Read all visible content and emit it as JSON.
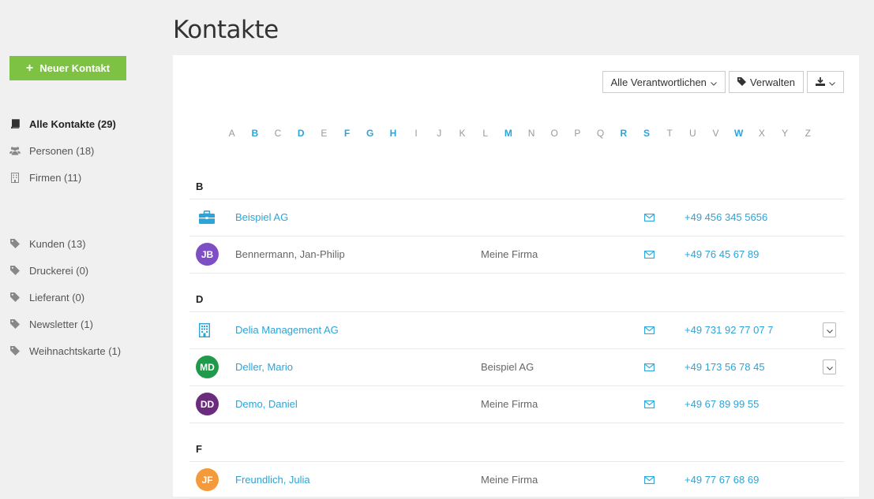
{
  "page": {
    "title": "Kontakte"
  },
  "new_button": {
    "label": "Neuer Kontakt"
  },
  "sidebar": {
    "items": [
      {
        "label": "Alle Kontakte (29)",
        "icon": "book-icon"
      },
      {
        "label": "Personen (18)",
        "icon": "people-icon"
      },
      {
        "label": "Firmen (11)",
        "icon": "building-icon"
      }
    ],
    "tags": [
      {
        "label": "Kunden (13)",
        "icon": "tag-icon"
      },
      {
        "label": "Druckerei (0)",
        "icon": "tag-icon"
      },
      {
        "label": "Lieferant (0)",
        "icon": "tag-icon"
      },
      {
        "label": "Newsletter (1)",
        "icon": "tag-icon"
      },
      {
        "label": "Weihnachtskarte (1)",
        "icon": "tag-icon"
      }
    ]
  },
  "toolbar": {
    "responsible_label": "Alle Verantwortlichen",
    "manage_label": "Verwalten"
  },
  "alphabet": {
    "letters": [
      "A",
      "B",
      "C",
      "D",
      "E",
      "F",
      "G",
      "H",
      "I",
      "J",
      "K",
      "L",
      "M",
      "N",
      "O",
      "P",
      "Q",
      "R",
      "S",
      "T",
      "U",
      "V",
      "W",
      "X",
      "Y",
      "Z"
    ],
    "active": [
      "B",
      "D",
      "F",
      "G",
      "H",
      "M",
      "R",
      "S",
      "W"
    ]
  },
  "groups": [
    {
      "letter": "B",
      "rows": [
        {
          "kind": "company",
          "icon": "briefcase-icon",
          "name": "Beispiel AG",
          "company": "",
          "phone": "+49 456 345 5656",
          "dropdown": false
        },
        {
          "kind": "person",
          "initials": "JB",
          "avatar_color": "#7e4fc4",
          "name": "Bennermann, Jan-Philip",
          "name_linked": false,
          "company": "Meine Firma",
          "phone": "+49 76 45 67 89",
          "dropdown": false
        }
      ]
    },
    {
      "letter": "D",
      "rows": [
        {
          "kind": "company",
          "icon": "building-icon",
          "name": "Delia Management AG",
          "company": "",
          "phone": "+49 731 92 77 07 7",
          "dropdown": true
        },
        {
          "kind": "person",
          "initials": "MD",
          "avatar_color": "#1f9a4a",
          "name": "Deller, Mario",
          "name_linked": true,
          "company": "Beispiel AG",
          "phone": "+49 173 56 78 45",
          "dropdown": true
        },
        {
          "kind": "person",
          "initials": "DD",
          "avatar_color": "#6b2c7d",
          "name": "Demo, Daniel",
          "name_linked": true,
          "company": "Meine Firma",
          "phone": "+49 67 89 99 55",
          "dropdown": false
        }
      ]
    },
    {
      "letter": "F",
      "rows": [
        {
          "kind": "person",
          "initials": "JF",
          "avatar_color": "#f59a3a",
          "name": "Freundlich, Julia",
          "name_linked": true,
          "company": "Meine Firma",
          "phone": "+49 77 67 68 69",
          "dropdown": false
        }
      ]
    }
  ]
}
